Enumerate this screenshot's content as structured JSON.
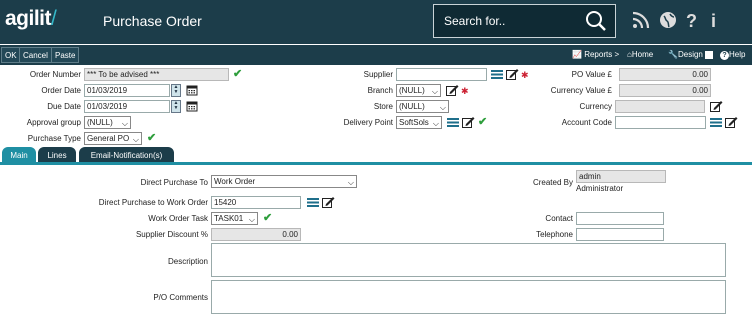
{
  "header": {
    "logo_main": "agilit",
    "logo_slash": "/",
    "title": "Purchase Order",
    "search_placeholder": "Search for.."
  },
  "toolbar": {
    "ok": "OK",
    "cancel": "Cancel",
    "paste": "Paste",
    "reports": "Reports",
    "reports_caret": ">",
    "home": "Home",
    "design": "Design",
    "help": "Help"
  },
  "form": {
    "order_number_label": "Order Number",
    "order_number_value": "*** To be advised ***",
    "order_date_label": "Order Date",
    "order_date_value": "01/03/2019",
    "due_date_label": "Due Date",
    "due_date_value": "01/03/2019",
    "approval_group_label": "Approval group",
    "approval_group_value": "(NULL)",
    "purchase_type_label": "Purchase Type",
    "purchase_type_value": "General PO",
    "supplier_label": "Supplier",
    "supplier_value": "",
    "branch_label": "Branch",
    "branch_value": "(NULL)",
    "store_label": "Store",
    "store_value": "(NULL)",
    "delivery_point_label": "Delivery Point",
    "delivery_point_value": "SoftSols",
    "po_value_label": "PO Value",
    "po_value_currency": "£",
    "po_value_value": "0.00",
    "currency_value_label": "Currency Value",
    "currency_value_currency": "£",
    "currency_value_value": "0.00",
    "currency_label": "Currency",
    "currency_value": "",
    "account_code_label": "Account Code",
    "account_code_value": ""
  },
  "tabs": [
    {
      "label": "Main",
      "active": true
    },
    {
      "label": "Lines",
      "active": false
    },
    {
      "label": "Email-Notification(s)",
      "active": false
    }
  ],
  "main": {
    "direct_purchase_to_label": "Direct Purchase To",
    "direct_purchase_to_value": "Work Order",
    "direct_purchase_wo_label": "Direct Purchase to Work Order",
    "direct_purchase_wo_value": "15420",
    "wo_task_label": "Work Order Task",
    "wo_task_value": "TASK01",
    "supplier_discount_label": "Supplier Discount %",
    "supplier_discount_value": "0.00",
    "created_by_label": "Created By",
    "created_by_value": "admin",
    "created_by_name": "Administrator",
    "contact_label": "Contact",
    "contact_value": "",
    "telephone_label": "Telephone",
    "telephone_value": "",
    "description_label": "Description",
    "po_comments_label": "P/O Comments"
  },
  "colors": {
    "header_bg": "#1c3d4a",
    "accent": "#1f8fa3",
    "check_green": "#2e9e3c",
    "required_red": "#cc2233"
  },
  "icons": [
    "search-icon",
    "rss-icon",
    "globe-icon",
    "help-icon",
    "info-icon",
    "calendar-icon",
    "list-icon",
    "edit-icon",
    "check-icon",
    "required-asterisk"
  ]
}
